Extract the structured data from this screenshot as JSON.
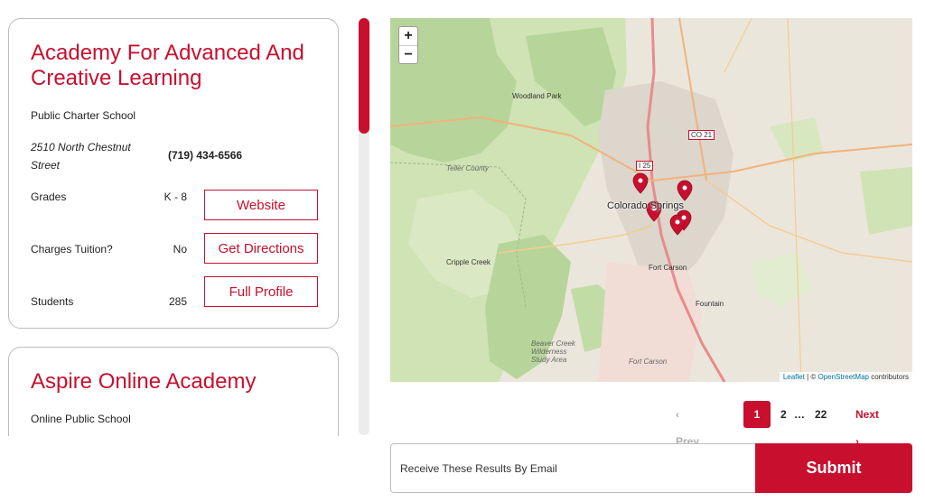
{
  "schools": [
    {
      "name": "Academy For Advanced And Creative Learning",
      "type": "Public Charter School",
      "address": "2510 North Chestnut Street",
      "phone": "(719) 434-6566",
      "grades_label": "Grades",
      "grades": "K - 8",
      "tuition_label": "Charges Tuition?",
      "tuition": "No",
      "students_label": "Students",
      "students": "285",
      "website_label": "Website",
      "directions_label": "Get Directions",
      "profile_label": "Full Profile"
    },
    {
      "name": "Aspire Online Academy",
      "type": "Online Public School"
    }
  ],
  "map": {
    "zoom_in": "+",
    "zoom_out": "−",
    "places": {
      "woodland_park": "Woodland Park",
      "teller_county": "Teller County",
      "colorado_springs": "Colorado Springs",
      "cripple_creek": "Cripple Creek",
      "fort_carson_town": "Fort Carson",
      "fountain": "Fountain",
      "beaver_creek": "Beaver Creek Wilderness Study Area",
      "fort_carson_area": "Fort Carson",
      "i25": "I 25",
      "co21": "CO 21"
    },
    "attribution": {
      "leaflet": "Leaflet",
      "sep": " | © ",
      "osm": "OpenStreetMap",
      "contributors": " contributors"
    },
    "marker_count": 5
  },
  "pagination": {
    "prev": "‹  Prev",
    "current": "1",
    "page2": "2",
    "ellipsis": "…",
    "last": "22",
    "next": "Next  ›"
  },
  "email": {
    "placeholder": "Receive These Results By Email",
    "submit_label": "Submit"
  },
  "colors": {
    "brand_red": "#c8102e",
    "map_green": "#b5d49a"
  }
}
